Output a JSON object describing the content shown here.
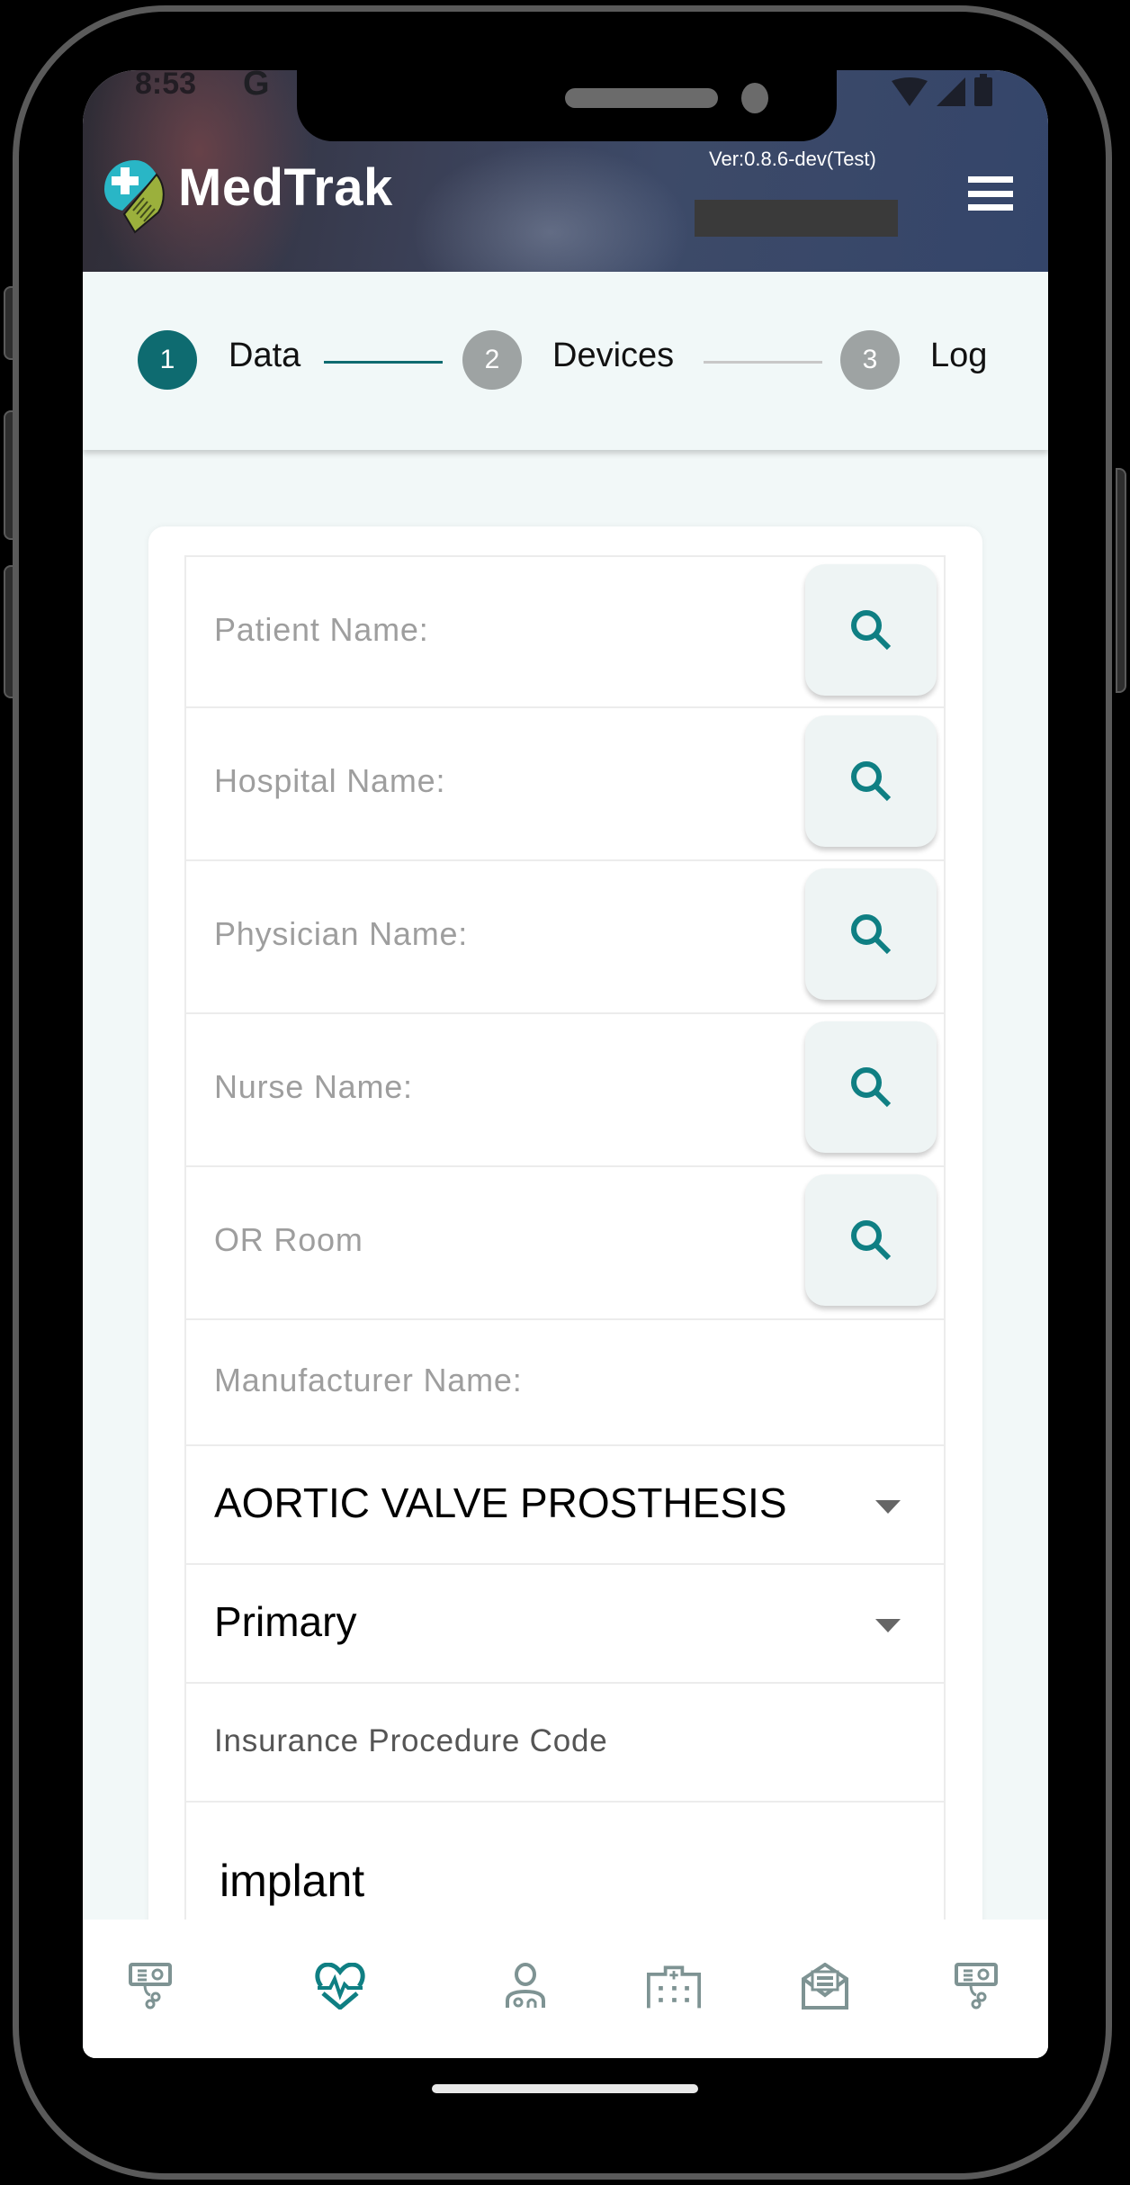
{
  "status_bar": {
    "time": "8:53",
    "carrier_icon": "google-g-icon",
    "icons": [
      "wifi-icon",
      "signal-icon",
      "battery-icon"
    ]
  },
  "header": {
    "brand": "MedTrak",
    "logo_icon": "medtrak-logo-icon",
    "version": "Ver:0.8.6-dev(Test)",
    "menu_icon": "hamburger-menu-icon"
  },
  "stepper": {
    "steps": [
      {
        "number": "1",
        "label": "Data",
        "state": "active"
      },
      {
        "number": "2",
        "label": "Devices",
        "state": "inactive"
      },
      {
        "number": "3",
        "label": "Log",
        "state": "inactive"
      }
    ]
  },
  "form": {
    "search_fields": [
      {
        "placeholder": "Patient Name:",
        "value": ""
      },
      {
        "placeholder": "Hospital Name:",
        "value": ""
      },
      {
        "placeholder": "Physician Name:",
        "value": ""
      },
      {
        "placeholder": "Nurse Name:",
        "value": ""
      },
      {
        "placeholder": "OR Room",
        "value": ""
      }
    ],
    "manufacturer": {
      "placeholder": "Manufacturer Name:",
      "value": ""
    },
    "device_type_select": {
      "value": "AORTIC VALVE PROSTHESIS"
    },
    "priority_select": {
      "value": "Primary"
    },
    "insurance_code": {
      "label": "Insurance Procedure Code"
    },
    "procedure_type": {
      "value": "implant"
    }
  },
  "bottom_nav": {
    "items": [
      {
        "icon": "device-monitor-icon",
        "active": false
      },
      {
        "icon": "heart-pulse-icon",
        "active": true
      },
      {
        "icon": "doctor-icon",
        "active": false
      },
      {
        "icon": "hospital-icon",
        "active": false
      },
      {
        "icon": "open-mail-icon",
        "active": false
      },
      {
        "icon": "device-monitor-icon",
        "active": false
      }
    ]
  },
  "colors": {
    "primary": "#0e6b70",
    "icon_accent": "#0f7f83",
    "inactive_step": "#9ea3a3",
    "inactive_icon": "#7e9393",
    "placeholder_text": "#9e9e9e"
  }
}
